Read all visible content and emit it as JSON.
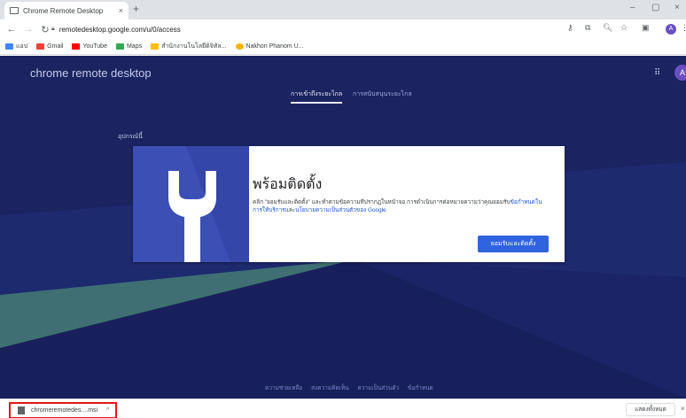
{
  "browser": {
    "tab_title": "Chrome Remote Desktop",
    "tab_close": "×",
    "new_tab": "+",
    "url": "remotedesktop.google.com/u/0/access",
    "window_controls": [
      "–",
      "▢",
      "×"
    ],
    "profile_initial": "A",
    "bookmarks": [
      {
        "label": "แอป",
        "color": "#4285f4"
      },
      {
        "label": "Gmail",
        "color": "#ea4335"
      },
      {
        "label": "YouTube",
        "color": "#ff0000"
      },
      {
        "label": "Maps",
        "color": "#34a853"
      },
      {
        "label": "สำนักงานโนโลยีดิจิทัล...",
        "color": "#fbbc04"
      },
      {
        "label": "Nakhon Phanom U...",
        "color": "#f4b400"
      }
    ]
  },
  "page": {
    "brand": "chrome remote desktop",
    "avatar_initial": "A",
    "tabs": [
      {
        "label": "การเข้าถึงระยะไกล",
        "active": true
      },
      {
        "label": "การสนับสนุนระยะไกล",
        "active": false
      }
    ],
    "section_label": "อุปกรณ์นี้",
    "card": {
      "title": "พร้อมติดตั้ง",
      "text_before": "คลิก \"ยอมรับและติดตั้ง\" และทำตามข้อความที่ปรากฏในหน้าจอ การดำเนินการต่อหมายความว่าคุณยอมรับ",
      "text_link1": "ข้อกำหนดในการให้บริการ",
      "text_mid": "และ",
      "text_link2": "นโยบายความเป็นส่วนตัวของ Google",
      "button_label": "ยอมรับและติดตั้ง"
    },
    "footer_links": [
      "ความช่วยเหลือ",
      "ส่งความคิดเห็น",
      "ความเป็นส่วนตัว",
      "ข้อกำหนด"
    ]
  },
  "download_bar": {
    "filename": "chromeremotedes....msi",
    "chevron": "^",
    "show_all": "แสดงทั้งหมด",
    "close": "×"
  }
}
